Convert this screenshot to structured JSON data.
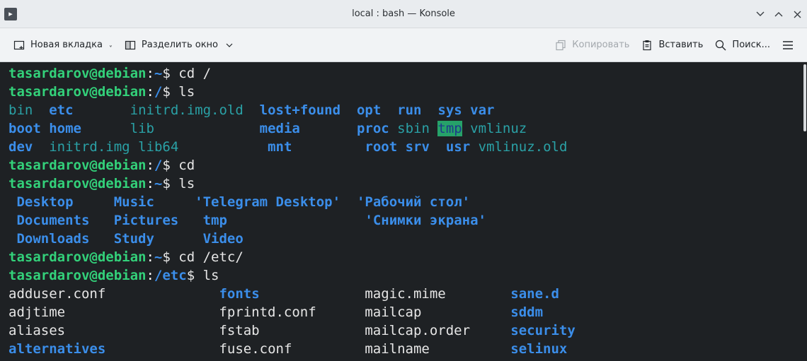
{
  "window": {
    "title": "local : bash — Konsole"
  },
  "toolbar": {
    "new_tab": "Новая вкладка",
    "split_view": "Разделить окно",
    "copy": "Копировать",
    "paste": "Вставить",
    "find": "Поиск..."
  },
  "colors": {
    "prompt_user": "#33d17a",
    "prompt_path": "#3b8eea",
    "directory": "#3b8eea",
    "symlink": "#2aa1a6",
    "tmp_highlight_bg": "#26a269",
    "terminal_bg": "#1e2124",
    "text": "#e6e6e6"
  },
  "terminal": {
    "lines": [
      [
        {
          "t": "tasardarov@debian",
          "c": "user"
        },
        {
          "t": ":",
          "c": "sym"
        },
        {
          "t": "~",
          "c": "path"
        },
        {
          "t": "$ cd /",
          "c": "plain"
        }
      ],
      [
        {
          "t": "tasardarov@debian",
          "c": "user"
        },
        {
          "t": ":",
          "c": "sym"
        },
        {
          "t": "/",
          "c": "path"
        },
        {
          "t": "$ ls",
          "c": "plain"
        }
      ],
      [
        {
          "t": "bin",
          "c": "link"
        },
        {
          "t": "  ",
          "c": "plain"
        },
        {
          "t": "etc",
          "c": "dir"
        },
        {
          "t": "       ",
          "c": "plain"
        },
        {
          "t": "initrd.img.old",
          "c": "link"
        },
        {
          "t": "  ",
          "c": "plain"
        },
        {
          "t": "lost+found",
          "c": "dir"
        },
        {
          "t": "  ",
          "c": "plain"
        },
        {
          "t": "opt",
          "c": "dir"
        },
        {
          "t": "  ",
          "c": "plain"
        },
        {
          "t": "run",
          "c": "dir"
        },
        {
          "t": "  ",
          "c": "plain"
        },
        {
          "t": "sys",
          "c": "dir"
        },
        {
          "t": " ",
          "c": "plain"
        },
        {
          "t": "var",
          "c": "dir"
        }
      ],
      [
        {
          "t": "boot",
          "c": "dir"
        },
        {
          "t": " ",
          "c": "plain"
        },
        {
          "t": "home",
          "c": "dir"
        },
        {
          "t": "      ",
          "c": "plain"
        },
        {
          "t": "lib",
          "c": "link"
        },
        {
          "t": "             ",
          "c": "plain"
        },
        {
          "t": "media",
          "c": "dir"
        },
        {
          "t": "       ",
          "c": "plain"
        },
        {
          "t": "proc",
          "c": "dir"
        },
        {
          "t": " ",
          "c": "plain"
        },
        {
          "t": "sbin",
          "c": "link"
        },
        {
          "t": " ",
          "c": "plain"
        },
        {
          "t": "tmp",
          "c": "tmp"
        },
        {
          "t": " ",
          "c": "plain"
        },
        {
          "t": "vmlinuz",
          "c": "link"
        }
      ],
      [
        {
          "t": "dev",
          "c": "dir"
        },
        {
          "t": "  ",
          "c": "plain"
        },
        {
          "t": "initrd.img",
          "c": "link"
        },
        {
          "t": " ",
          "c": "plain"
        },
        {
          "t": "lib64",
          "c": "link"
        },
        {
          "t": "           ",
          "c": "plain"
        },
        {
          "t": "mnt",
          "c": "dir"
        },
        {
          "t": "         ",
          "c": "plain"
        },
        {
          "t": "root",
          "c": "dir"
        },
        {
          "t": " ",
          "c": "plain"
        },
        {
          "t": "srv",
          "c": "dir"
        },
        {
          "t": "  ",
          "c": "plain"
        },
        {
          "t": "usr",
          "c": "dir"
        },
        {
          "t": " ",
          "c": "plain"
        },
        {
          "t": "vmlinuz.old",
          "c": "link"
        }
      ],
      [
        {
          "t": "tasardarov@debian",
          "c": "user"
        },
        {
          "t": ":",
          "c": "sym"
        },
        {
          "t": "/",
          "c": "path"
        },
        {
          "t": "$ cd",
          "c": "plain"
        }
      ],
      [
        {
          "t": "tasardarov@debian",
          "c": "user"
        },
        {
          "t": ":",
          "c": "sym"
        },
        {
          "t": "~",
          "c": "path"
        },
        {
          "t": "$ ls",
          "c": "plain"
        }
      ],
      [
        {
          "t": " ",
          "c": "plain"
        },
        {
          "t": "Desktop",
          "c": "dir"
        },
        {
          "t": "     ",
          "c": "plain"
        },
        {
          "t": "Music",
          "c": "dir"
        },
        {
          "t": "     ",
          "c": "plain"
        },
        {
          "t": "'Telegram Desktop'",
          "c": "quote"
        },
        {
          "t": "  ",
          "c": "plain"
        },
        {
          "t": "'Рабочий стол'",
          "c": "quote"
        }
      ],
      [
        {
          "t": " ",
          "c": "plain"
        },
        {
          "t": "Documents",
          "c": "dir"
        },
        {
          "t": "   ",
          "c": "plain"
        },
        {
          "t": "Pictures",
          "c": "dir"
        },
        {
          "t": "   ",
          "c": "plain"
        },
        {
          "t": "tmp",
          "c": "dir"
        },
        {
          "t": "                 ",
          "c": "plain"
        },
        {
          "t": "'Снимки экрана'",
          "c": "quote"
        }
      ],
      [
        {
          "t": " ",
          "c": "plain"
        },
        {
          "t": "Downloads",
          "c": "dir"
        },
        {
          "t": "   ",
          "c": "plain"
        },
        {
          "t": "Study",
          "c": "dir"
        },
        {
          "t": "      ",
          "c": "plain"
        },
        {
          "t": "Video",
          "c": "dir"
        }
      ],
      [
        {
          "t": "tasardarov@debian",
          "c": "user"
        },
        {
          "t": ":",
          "c": "sym"
        },
        {
          "t": "~",
          "c": "path"
        },
        {
          "t": "$ cd /etc/",
          "c": "plain"
        }
      ],
      [
        {
          "t": "tasardarov@debian",
          "c": "user"
        },
        {
          "t": ":",
          "c": "sym"
        },
        {
          "t": "/etc",
          "c": "path"
        },
        {
          "t": "$ ls",
          "c": "plain"
        }
      ],
      [
        {
          "t": "adduser.conf",
          "c": "plain"
        },
        {
          "t": "              ",
          "c": "plain"
        },
        {
          "t": "fonts",
          "c": "dir"
        },
        {
          "t": "             ",
          "c": "plain"
        },
        {
          "t": "magic.mime",
          "c": "plain"
        },
        {
          "t": "        ",
          "c": "plain"
        },
        {
          "t": "sane.d",
          "c": "dir"
        }
      ],
      [
        {
          "t": "adjtime",
          "c": "plain"
        },
        {
          "t": "                   ",
          "c": "plain"
        },
        {
          "t": "fprintd.conf",
          "c": "plain"
        },
        {
          "t": "      ",
          "c": "plain"
        },
        {
          "t": "mailcap",
          "c": "plain"
        },
        {
          "t": "           ",
          "c": "plain"
        },
        {
          "t": "sddm",
          "c": "dir"
        }
      ],
      [
        {
          "t": "aliases",
          "c": "plain"
        },
        {
          "t": "                   ",
          "c": "plain"
        },
        {
          "t": "fstab",
          "c": "plain"
        },
        {
          "t": "             ",
          "c": "plain"
        },
        {
          "t": "mailcap.order",
          "c": "plain"
        },
        {
          "t": "     ",
          "c": "plain"
        },
        {
          "t": "security",
          "c": "dir"
        }
      ],
      [
        {
          "t": "alternatives",
          "c": "dir"
        },
        {
          "t": "              ",
          "c": "plain"
        },
        {
          "t": "fuse.conf",
          "c": "plain"
        },
        {
          "t": "         ",
          "c": "plain"
        },
        {
          "t": "mailname",
          "c": "plain"
        },
        {
          "t": "          ",
          "c": "plain"
        },
        {
          "t": "selinux",
          "c": "dir"
        }
      ]
    ]
  }
}
